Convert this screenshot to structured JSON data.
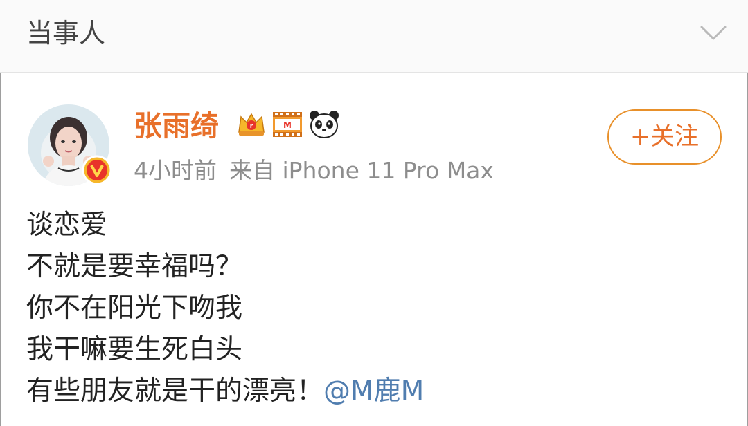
{
  "header": {
    "title": "当事人",
    "collapse_icon": "chevron-down-icon"
  },
  "post": {
    "user": {
      "name": "张雨绮",
      "badges": [
        "crown-icon",
        "movie-icon",
        "panda-icon"
      ],
      "verified_icon": "verified-v-icon"
    },
    "meta": {
      "time": "4小时前",
      "source": "来自 iPhone 11 Pro Max"
    },
    "follow_label": "+关注",
    "content": {
      "lines": [
        "谈恋爱",
        "不就是要幸福吗？",
        "你不在阳光下吻我",
        "我干嘛要生死白头"
      ],
      "last_line_text": "有些朋友就是干的漂亮！",
      "mention": "@M鹿M"
    }
  },
  "colors": {
    "username": "#e8702a",
    "mention": "#507daf",
    "follow_border": "#e8902a",
    "meta": "#8d8d8d",
    "text": "#222222"
  }
}
